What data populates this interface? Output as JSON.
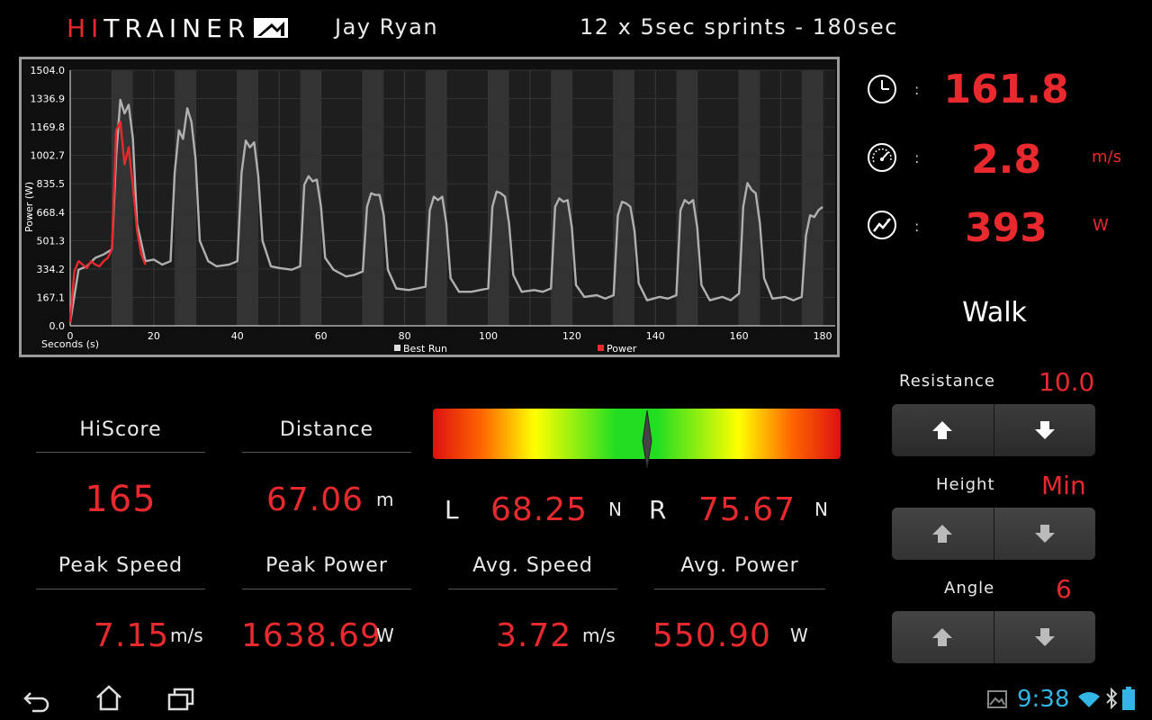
{
  "header": {
    "brand_hi": "HI",
    "brand_trainer": "TRAINER",
    "user_name": "Jay Ryan",
    "workout_title": "12 x 5sec sprints - 180sec"
  },
  "colors": {
    "accent_red": "#e8292e",
    "best_run_line": "#b0b0b0",
    "status_blue": "#33b5e5"
  },
  "chart_data": {
    "type": "line",
    "title": "",
    "xlabel": "Seconds (s)",
    "ylabel": "Power (W)",
    "xlim": [
      0,
      183
    ],
    "ylim": [
      0,
      1504
    ],
    "x_ticks": [
      0,
      20,
      40,
      60,
      80,
      100,
      120,
      140,
      160,
      180
    ],
    "x_tick_labels": [
      "0",
      "20",
      "40",
      "60",
      "80",
      "100",
      "120",
      "140",
      "160",
      "180"
    ],
    "y_ticks": [
      0,
      167.1,
      334.2,
      501.3,
      668.4,
      835.5,
      1002.7,
      1169.8,
      1336.9,
      1504
    ],
    "y_tick_labels": [
      "0.0",
      "167.1",
      "334.2",
      "501.3",
      "668.4",
      "835.5",
      "1002.7",
      "1169.8",
      "1336.9",
      "1504.0"
    ],
    "sprint_bands": [
      [
        10,
        15
      ],
      [
        25,
        30
      ],
      [
        40,
        45
      ],
      [
        55,
        60
      ],
      [
        70,
        75
      ],
      [
        85,
        90
      ],
      [
        100,
        105
      ],
      [
        115,
        120
      ],
      [
        130,
        135
      ],
      [
        145,
        150
      ],
      [
        160,
        165
      ],
      [
        175,
        180
      ]
    ],
    "legend": [
      "Best Run",
      "Power"
    ],
    "series": [
      {
        "name": "Best Run",
        "color": "#b0b0b0",
        "x": [
          0,
          2,
          4,
          6,
          8,
          10,
          11,
          12,
          13,
          14,
          15,
          16,
          18,
          20,
          22,
          24,
          25,
          26,
          27,
          28,
          29,
          30,
          31,
          33,
          35,
          38,
          40,
          41,
          42,
          43,
          44,
          45,
          46,
          48,
          50,
          53,
          55,
          56,
          57,
          58,
          59,
          60,
          61,
          63,
          66,
          68,
          70,
          71,
          72,
          73,
          74,
          75,
          76,
          78,
          81,
          83,
          85,
          86,
          87,
          88,
          89,
          90,
          91,
          93,
          96,
          98,
          100,
          101,
          102,
          103,
          104,
          105,
          106,
          108,
          111,
          113,
          115,
          116,
          117,
          118,
          119,
          120,
          121,
          123,
          126,
          128,
          130,
          131,
          132,
          133,
          134,
          135,
          136,
          138,
          141,
          143,
          145,
          146,
          147,
          148,
          149,
          150,
          151,
          153,
          156,
          158,
          160,
          161,
          162,
          163,
          164,
          165,
          166,
          168,
          171,
          173,
          175,
          176,
          177,
          178,
          179,
          180
        ],
        "values": [
          20,
          330,
          350,
          400,
          420,
          450,
          1000,
          1330,
          1250,
          1300,
          1100,
          600,
          380,
          390,
          360,
          380,
          900,
          1150,
          1100,
          1280,
          1200,
          980,
          500,
          380,
          350,
          360,
          380,
          900,
          1090,
          1050,
          1080,
          880,
          500,
          350,
          340,
          330,
          350,
          830,
          880,
          850,
          860,
          700,
          400,
          330,
          290,
          300,
          320,
          700,
          780,
          770,
          770,
          650,
          330,
          220,
          210,
          220,
          230,
          680,
          760,
          740,
          760,
          600,
          280,
          200,
          200,
          210,
          220,
          700,
          790,
          780,
          760,
          600,
          300,
          200,
          210,
          200,
          220,
          700,
          750,
          730,
          740,
          580,
          240,
          170,
          180,
          160,
          180,
          650,
          730,
          720,
          700,
          560,
          250,
          150,
          170,
          160,
          180,
          680,
          740,
          720,
          740,
          580,
          240,
          150,
          170,
          150,
          190,
          700,
          840,
          800,
          780,
          600,
          280,
          160,
          170,
          150,
          170,
          530,
          650,
          640,
          680,
          700
        ]
      },
      {
        "name": "Power",
        "color": "#e8292e",
        "x": [
          0,
          1,
          2,
          3,
          4,
          5,
          6,
          7,
          8,
          9,
          10,
          11,
          12,
          13,
          14,
          15,
          16,
          17,
          18
        ],
        "values": [
          20,
          320,
          380,
          360,
          340,
          380,
          360,
          350,
          380,
          400,
          450,
          1150,
          1200,
          950,
          1050,
          820,
          560,
          420,
          360
        ]
      }
    ]
  },
  "live": {
    "time_value": "161.8",
    "speed_value": "2.8",
    "speed_unit": "m/s",
    "power_value": "393",
    "power_unit": "W",
    "colon": ":"
  },
  "mode": "Walk",
  "controls": {
    "resistance_label": "Resistance",
    "resistance_value": "10.0",
    "height_label": "Height",
    "height_value": "Min",
    "angle_label": "Angle",
    "angle_value": "6"
  },
  "stats": {
    "hiscore_label": "HiScore",
    "hiscore_value": "165",
    "distance_label": "Distance",
    "distance_value": "67.06",
    "distance_unit": "m",
    "peak_speed_label": "Peak Speed",
    "peak_speed_value": "7.15",
    "peak_speed_unit": "m/s",
    "peak_power_label": "Peak Power",
    "peak_power_value": "1638.69",
    "peak_power_unit": "W",
    "avg_speed_label": "Avg. Speed",
    "avg_speed_value": "3.72",
    "avg_speed_unit": "m/s",
    "avg_power_label": "Avg. Power",
    "avg_power_value": "550.90",
    "avg_power_unit": "W"
  },
  "balance": {
    "left_label": "L",
    "left_value": "68.25",
    "left_unit": "N",
    "right_label": "R",
    "right_value": "75.67",
    "right_unit": "N",
    "needle_position": 0.525
  },
  "status_bar": {
    "clock": "9:38"
  }
}
